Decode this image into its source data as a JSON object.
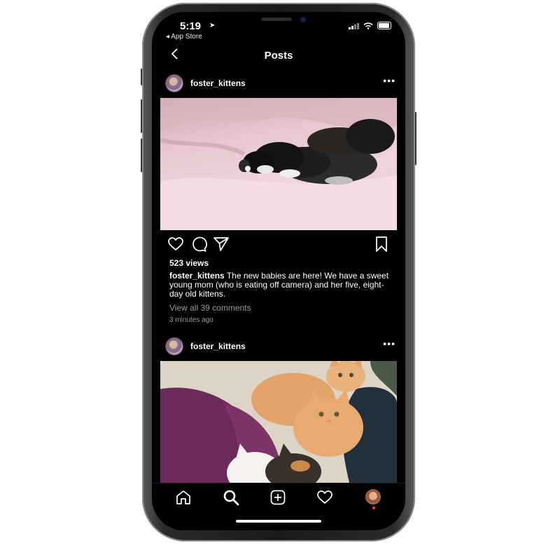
{
  "status_bar": {
    "time": "5:19",
    "back_app": "◂ App Store"
  },
  "header": {
    "title": "Posts"
  },
  "posts": [
    {
      "username": "foster_kittens",
      "more": "•••",
      "views": "523 views",
      "caption_user": "foster_kittens",
      "caption_text": " The new babies are here! We have a sweet young mom (who is eating off camera) and her five, eight-day old kittens.",
      "view_comments": "View all 39 comments",
      "timestamp": "3 minutes ago"
    },
    {
      "username": "foster_kittens",
      "more": "•••"
    }
  ],
  "tab_bar": {
    "items": [
      "home-icon",
      "search-icon",
      "new-post-icon",
      "activity-heart-icon",
      "profile-avatar"
    ]
  },
  "colors": {
    "background": "#000000",
    "text": "#ffffff",
    "secondary_text": "#9a9a9a",
    "notification": "#ff3040"
  }
}
